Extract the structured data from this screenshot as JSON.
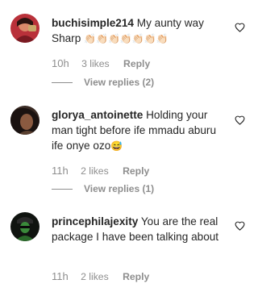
{
  "comments": [
    {
      "username": "buchisimple214",
      "text": "My aunty way Sharp",
      "emoji_text": "👏🏻👏🏻👏🏻👏🏻👏🏻👏🏻👏🏻",
      "time": "10h",
      "likes": "3 likes",
      "reply_label": "Reply",
      "view_replies": "View replies (2)"
    },
    {
      "username": "glorya_antoinette",
      "text": "Holding your man tight before ife mmadu aburu ife onye ozo",
      "emoji_text": "😅",
      "time": "11h",
      "likes": "2 likes",
      "reply_label": "Reply",
      "view_replies": "View replies (1)"
    },
    {
      "username": "princephilajexity",
      "text": "You are the real package I have been talking about",
      "time": "11h",
      "likes": "2 likes",
      "reply_label": "Reply"
    }
  ],
  "icons": {
    "like": "heart-outline-icon"
  },
  "colors": {
    "text": "#262626",
    "secondary": "#8e8e8e"
  }
}
